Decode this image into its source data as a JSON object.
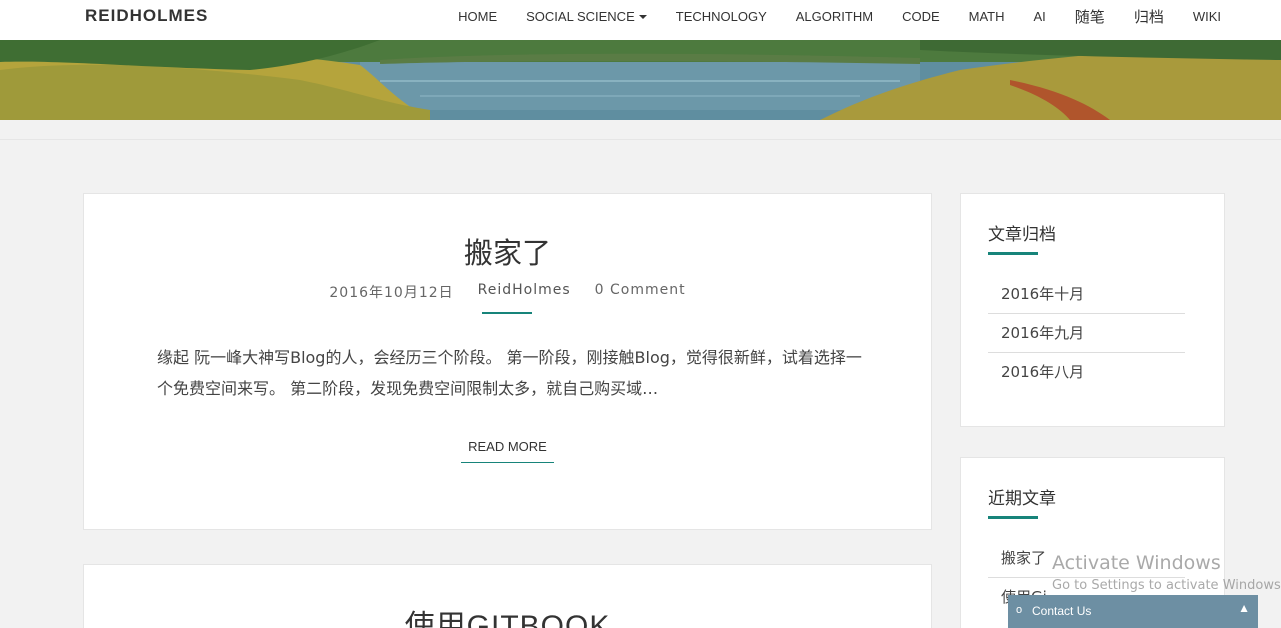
{
  "site": {
    "brand": "REIDHOLMES"
  },
  "nav": {
    "items": [
      "HOME",
      "SOCIAL SCIENCE",
      "TECHNOLOGY",
      "ALGORITHM",
      "CODE",
      "MATH",
      "AI",
      "随笔",
      "归档",
      "WIKI"
    ]
  },
  "posts": [
    {
      "title": "搬家了",
      "date": "2016年10月12日",
      "author": "ReidHolmes",
      "comments": "0 Comment",
      "excerpt": "缘起 阮一峰大神写Blog的人，会经历三个阶段。 第一阶段，刚接触Blog，觉得很新鲜，试着选择一个免费空间来写。 第二阶段，发现免费空间限制太多，就自己购买域…",
      "read_more": "READ MORE"
    },
    {
      "title": "使用GITBOOK"
    }
  ],
  "sidebar": {
    "archive": {
      "title": "文章归档",
      "items": [
        "2016年十月",
        "2016年九月",
        "2016年八月"
      ]
    },
    "recent": {
      "title": "近期文章",
      "items": [
        "搬家了",
        "使用Gi..."
      ]
    }
  },
  "overlay": {
    "activate_title": "Activate Windows",
    "activate_sub": "Go to Settings to activate Windows."
  },
  "contact": {
    "label": "Contact Us",
    "dot": "o",
    "arrow": "▲"
  },
  "colors": {
    "accent": "#17847a",
    "contact_bg": "#6d8fa3",
    "page_bg": "#f2f2f2"
  }
}
